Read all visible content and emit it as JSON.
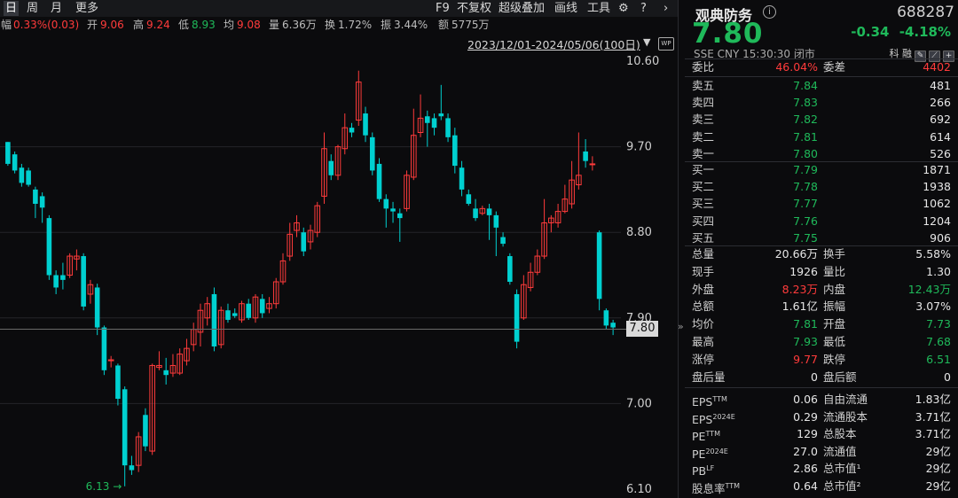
{
  "toolbar": {
    "tabs": [
      "日",
      "周",
      "月",
      "更多"
    ],
    "right": [
      "F9",
      "不复权",
      "超级叠加",
      "画线",
      "工具"
    ]
  },
  "infobar": {
    "fu_label": "幅",
    "fu_val": "0.33%(0.03)",
    "kai_label": "开",
    "kai_val": "9.06",
    "gao_label": "高",
    "gao_val": "9.24",
    "di_label": "低",
    "di_val": "8.93",
    "jun_label": "均",
    "jun_val": "9.08",
    "liang_label": "量",
    "liang_val": "6.36万",
    "huan_label": "换",
    "huan_val": "1.72%",
    "zhen_label": "振",
    "zhen_val": "3.44%",
    "e_label": "额",
    "e_val": "5775万"
  },
  "range": "2023/12/01-2024/05/06(100日)",
  "wp_label": "WP",
  "current_price_tag": "7.80",
  "low_marker": "6.13",
  "colors": {
    "up": "#ff3b3b",
    "down": "#00d0d0",
    "green": "#1fb95a",
    "bg": "#0b0b0d"
  },
  "chart_data": {
    "type": "candlestick",
    "ylim": [
      6.1,
      10.6
    ],
    "y_ticks": [
      "10.60",
      "9.70",
      "8.80",
      "7.90",
      "7.00",
      "6.10"
    ],
    "candles": [
      [
        9.75,
        9.52,
        9.75,
        9.5
      ],
      [
        9.62,
        9.45,
        9.65,
        9.42
      ],
      [
        9.48,
        9.32,
        9.52,
        9.28
      ],
      [
        9.45,
        9.3,
        9.48,
        9.28
      ],
      [
        9.25,
        9.1,
        9.28,
        8.95
      ],
      [
        9.18,
        9.06,
        9.22,
        8.9
      ],
      [
        8.95,
        8.35,
        8.98,
        8.3
      ],
      [
        8.35,
        8.22,
        8.4,
        8.15
      ],
      [
        8.35,
        8.3,
        8.48,
        8.2
      ],
      [
        8.35,
        8.55,
        8.58,
        8.32
      ],
      [
        8.52,
        8.55,
        8.62,
        8.4
      ],
      [
        8.55,
        8.02,
        8.58,
        7.98
      ],
      [
        8.15,
        8.25,
        8.3,
        8.05
      ],
      [
        8.22,
        7.8,
        8.26,
        7.72
      ],
      [
        7.8,
        7.35,
        7.82,
        7.3
      ],
      [
        7.45,
        7.46,
        7.5,
        7.38
      ],
      [
        7.4,
        7.05,
        7.42,
        6.98
      ],
      [
        7.15,
        6.35,
        7.18,
        6.13
      ],
      [
        6.35,
        6.3,
        6.45,
        6.25
      ],
      [
        6.35,
        6.65,
        6.7,
        6.28
      ],
      [
        6.88,
        6.55,
        6.95,
        6.5
      ],
      [
        6.5,
        7.4,
        7.42,
        6.46
      ],
      [
        7.38,
        7.4,
        7.55,
        7.35
      ],
      [
        7.35,
        7.3,
        7.48,
        7.2
      ],
      [
        7.32,
        7.4,
        7.52,
        7.28
      ],
      [
        7.32,
        7.52,
        7.58,
        7.3
      ],
      [
        7.45,
        7.58,
        7.68,
        7.4
      ],
      [
        7.62,
        7.78,
        7.85,
        7.55
      ],
      [
        7.75,
        7.98,
        8.05,
        7.6
      ],
      [
        7.9,
        8.05,
        8.12,
        7.82
      ],
      [
        8.15,
        7.6,
        8.22,
        7.55
      ],
      [
        7.62,
        7.98,
        8.02,
        7.58
      ],
      [
        7.98,
        7.88,
        8.05,
        7.85
      ],
      [
        7.95,
        7.92,
        8.0,
        7.9
      ],
      [
        7.88,
        8.05,
        8.08,
        7.85
      ],
      [
        8.05,
        7.9,
        8.1,
        7.88
      ],
      [
        7.9,
        8.12,
        8.15,
        7.85
      ],
      [
        8.1,
        7.95,
        8.15,
        7.9
      ],
      [
        8.0,
        8.05,
        8.12,
        7.95
      ],
      [
        8.05,
        8.28,
        8.32,
        8.0
      ],
      [
        8.28,
        8.5,
        8.58,
        8.25
      ],
      [
        8.55,
        8.78,
        8.9,
        8.5
      ],
      [
        8.82,
        8.9,
        8.98,
        8.75
      ],
      [
        8.8,
        8.6,
        8.85,
        8.55
      ],
      [
        8.7,
        8.82,
        8.88,
        8.62
      ],
      [
        8.8,
        9.08,
        9.12,
        8.75
      ],
      [
        9.18,
        9.68,
        9.85,
        9.1
      ],
      [
        9.55,
        9.4,
        9.62,
        9.35
      ],
      [
        9.4,
        9.7,
        9.72,
        9.35
      ],
      [
        9.68,
        9.9,
        10.05,
        9.62
      ],
      [
        9.9,
        9.85,
        9.95,
        9.8
      ],
      [
        9.98,
        10.38,
        10.5,
        9.92
      ],
      [
        10.05,
        9.82,
        10.12,
        9.75
      ],
      [
        9.8,
        9.45,
        9.85,
        9.4
      ],
      [
        9.52,
        9.15,
        9.58,
        9.12
      ],
      [
        9.15,
        9.05,
        9.2,
        8.85
      ],
      [
        9.05,
        9.02,
        9.12,
        8.9
      ],
      [
        9.0,
        8.95,
        9.05,
        8.7
      ],
      [
        9.05,
        9.4,
        9.45,
        9.02
      ],
      [
        9.38,
        9.82,
        10.1,
        9.35
      ],
      [
        9.85,
        10.0,
        10.25,
        9.8
      ],
      [
        10.02,
        9.95,
        10.08,
        9.7
      ],
      [
        10.0,
        9.9,
        10.05,
        9.82
      ],
      [
        10.05,
        10.02,
        10.35,
        9.98
      ],
      [
        10.0,
        9.8,
        10.05,
        9.75
      ],
      [
        9.82,
        9.5,
        9.9,
        9.42
      ],
      [
        9.48,
        9.25,
        9.55,
        9.18
      ],
      [
        9.2,
        9.1,
        9.25,
        9.08
      ],
      [
        9.05,
        8.95,
        9.15,
        8.92
      ],
      [
        9.0,
        9.05,
        9.08,
        8.98
      ],
      [
        9.05,
        8.98,
        9.1,
        8.72
      ],
      [
        8.98,
        8.85,
        9.02,
        8.55
      ],
      [
        8.75,
        8.68,
        8.8,
        8.65
      ],
      [
        8.55,
        8.28,
        8.58,
        8.25
      ],
      [
        8.15,
        7.65,
        8.2,
        7.58
      ],
      [
        7.9,
        8.25,
        8.35,
        7.88
      ],
      [
        8.22,
        8.38,
        8.48,
        8.18
      ],
      [
        8.38,
        8.55,
        8.62,
        8.35
      ],
      [
        8.55,
        8.9,
        9.15,
        8.52
      ],
      [
        8.9,
        8.95,
        8.98,
        8.8
      ],
      [
        8.9,
        9.02,
        9.1,
        8.85
      ],
      [
        9.02,
        9.15,
        9.3,
        9.0
      ],
      [
        9.1,
        9.35,
        9.55,
        9.05
      ],
      [
        9.3,
        9.4,
        9.85,
        9.25
      ],
      [
        9.65,
        9.55,
        9.78,
        9.48
      ],
      [
        9.52,
        9.52,
        9.6,
        9.45
      ],
      [
        8.8,
        8.1,
        8.82,
        7.98
      ],
      [
        7.98,
        7.82,
        8.0,
        7.78
      ],
      [
        7.85,
        7.8,
        7.88,
        7.72
      ]
    ]
  },
  "quote": {
    "name": "观典防务",
    "code": "688287",
    "price": "7.80",
    "change": "-0.34",
    "change_pct": "-4.18%",
    "meta": "SSE  CNY  15:30:30  闭市",
    "tags": "科 融",
    "weibi_label": "委比",
    "weibi_val": "46.04%",
    "weicha_label": "委差",
    "weicha_val": "4402",
    "asks": [
      {
        "label": "卖五",
        "price": "7.84",
        "vol": "481"
      },
      {
        "label": "卖四",
        "price": "7.83",
        "vol": "266"
      },
      {
        "label": "卖三",
        "price": "7.82",
        "vol": "692"
      },
      {
        "label": "卖二",
        "price": "7.81",
        "vol": "614"
      },
      {
        "label": "卖一",
        "price": "7.80",
        "vol": "526"
      }
    ],
    "bids": [
      {
        "label": "买一",
        "price": "7.79",
        "vol": "1871"
      },
      {
        "label": "买二",
        "price": "7.78",
        "vol": "1938"
      },
      {
        "label": "买三",
        "price": "7.77",
        "vol": "1062"
      },
      {
        "label": "买四",
        "price": "7.76",
        "vol": "1204"
      },
      {
        "label": "买五",
        "price": "7.75",
        "vol": "906"
      }
    ],
    "stats": [
      {
        "l1": "总量",
        "v1": "20.66万",
        "l2": "换手",
        "v2": "5.58%",
        "c1": "w",
        "c2": "w"
      },
      {
        "l1": "现手",
        "v1": "1926",
        "l2": "量比",
        "v2": "1.30",
        "c1": "w",
        "c2": "w"
      },
      {
        "l1": "外盘",
        "v1": "8.23万",
        "l2": "内盘",
        "v2": "12.43万",
        "c1": "r",
        "c2": "g"
      },
      {
        "l1": "总额",
        "v1": "1.61亿",
        "l2": "振幅",
        "v2": "3.07%",
        "c1": "w",
        "c2": "w"
      },
      {
        "l1": "均价",
        "v1": "7.81",
        "l2": "开盘",
        "v2": "7.73",
        "c1": "g",
        "c2": "g"
      },
      {
        "l1": "最高",
        "v1": "7.93",
        "l2": "最低",
        "v2": "7.68",
        "c1": "g",
        "c2": "g"
      },
      {
        "l1": "涨停",
        "v1": "9.77",
        "l2": "跌停",
        "v2": "6.51",
        "c1": "r",
        "c2": "g"
      },
      {
        "l1": "盘后量",
        "v1": "0",
        "l2": "盘后额",
        "v2": "0",
        "c1": "w",
        "c2": "w"
      }
    ],
    "fund": [
      {
        "l1": "EPS",
        "s1": "TTM",
        "v1": "0.06",
        "l2": "自由流通",
        "v2": "1.83亿"
      },
      {
        "l1": "EPS",
        "s1": "2024E",
        "v1": "0.29",
        "l2": "流通股本",
        "v2": "3.71亿"
      },
      {
        "l1": "PE",
        "s1": "TTM",
        "v1": "129",
        "l2": "总股本",
        "v2": "3.71亿"
      },
      {
        "l1": "PE",
        "s1": "2024E",
        "v1": "27.0",
        "l2": "流通值",
        "v2": "29亿"
      },
      {
        "l1": "PB",
        "s1": "LF",
        "v1": "2.86",
        "l2": "总市值¹",
        "v2": "29亿"
      },
      {
        "l1": "股息率",
        "s1": "TTM",
        "v1": "0.64",
        "l2": "总市值²",
        "v2": "29亿"
      }
    ]
  }
}
